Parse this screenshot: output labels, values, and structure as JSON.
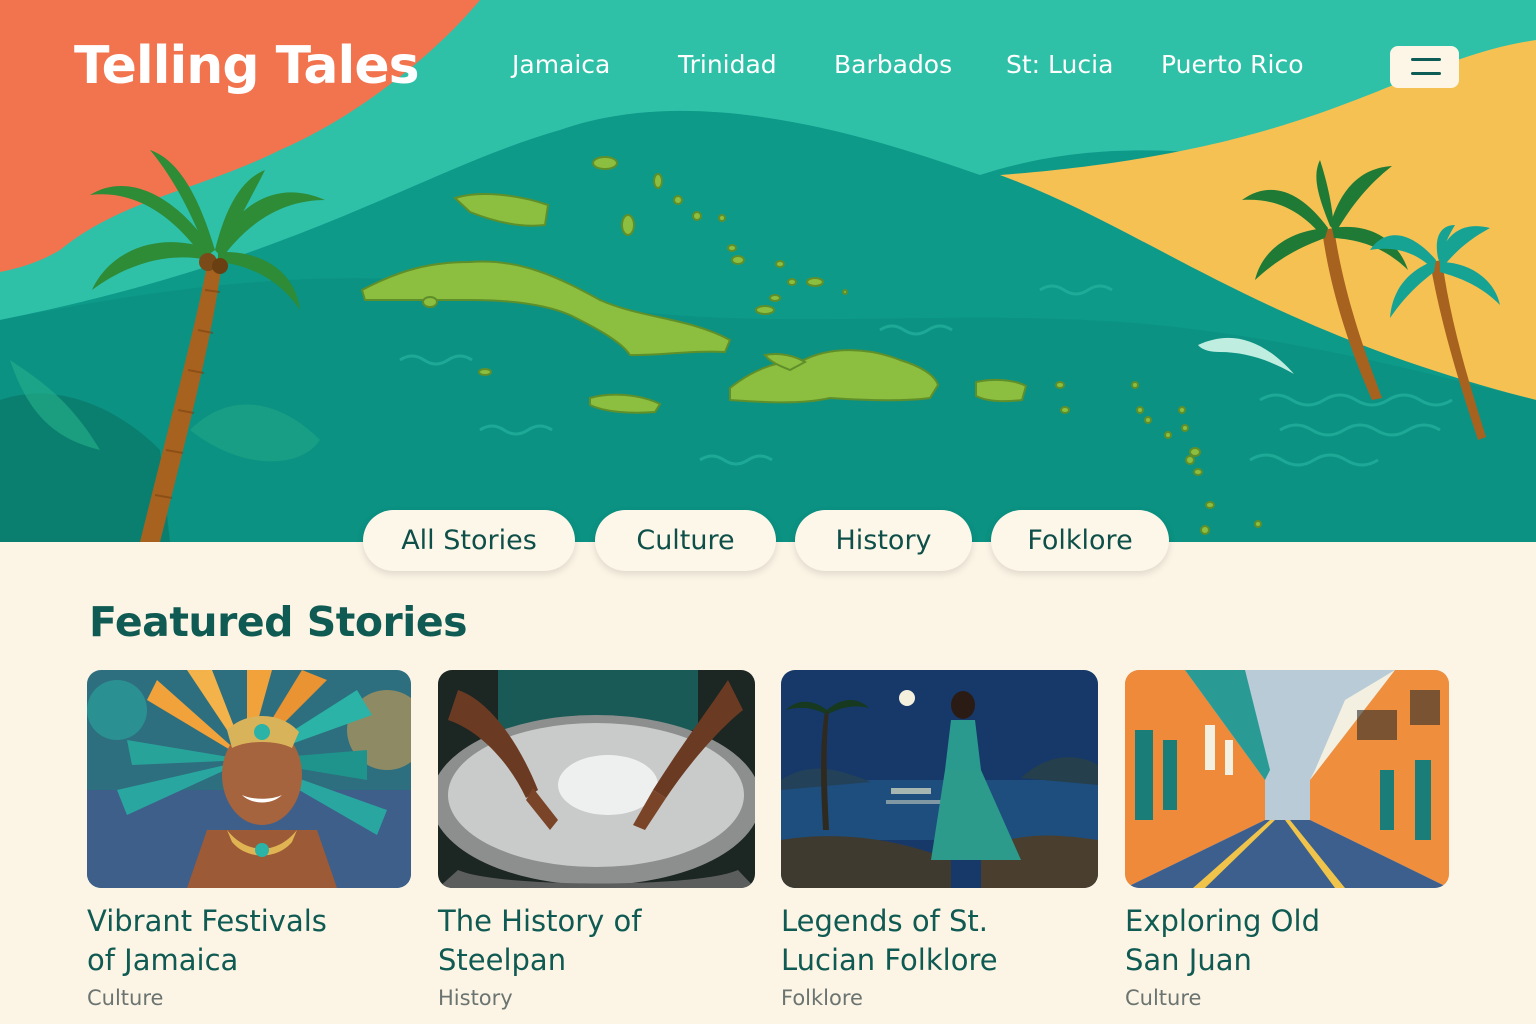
{
  "header": {
    "logo": "Telling Tales",
    "nav": [
      "Jamaica",
      "Trinidad",
      "Barbados",
      "St: Lucia",
      "Puerto Rico"
    ],
    "menu_icon": "hamburger-menu-icon"
  },
  "filters": [
    "All Stories",
    "Culture",
    "History",
    "Folklore"
  ],
  "featured": {
    "title": "Featured Stories",
    "cards": [
      {
        "title": "Vibrant Festivals\nof Jamaica",
        "category": "Culture"
      },
      {
        "title": "The History of\nSteelpan",
        "category": "History"
      },
      {
        "title": "Legends of St.\nLucian Folklore",
        "category": "Folklore"
      },
      {
        "title": "Exploring Old\nSan Juan",
        "category": "Culture"
      }
    ]
  },
  "colors": {
    "coral": "#f2744f",
    "teal": "#14a391",
    "sea": "#0d9a89",
    "sun": "#f6c153",
    "cream": "#fcf5e6",
    "dark_green": "#0f5a52"
  }
}
